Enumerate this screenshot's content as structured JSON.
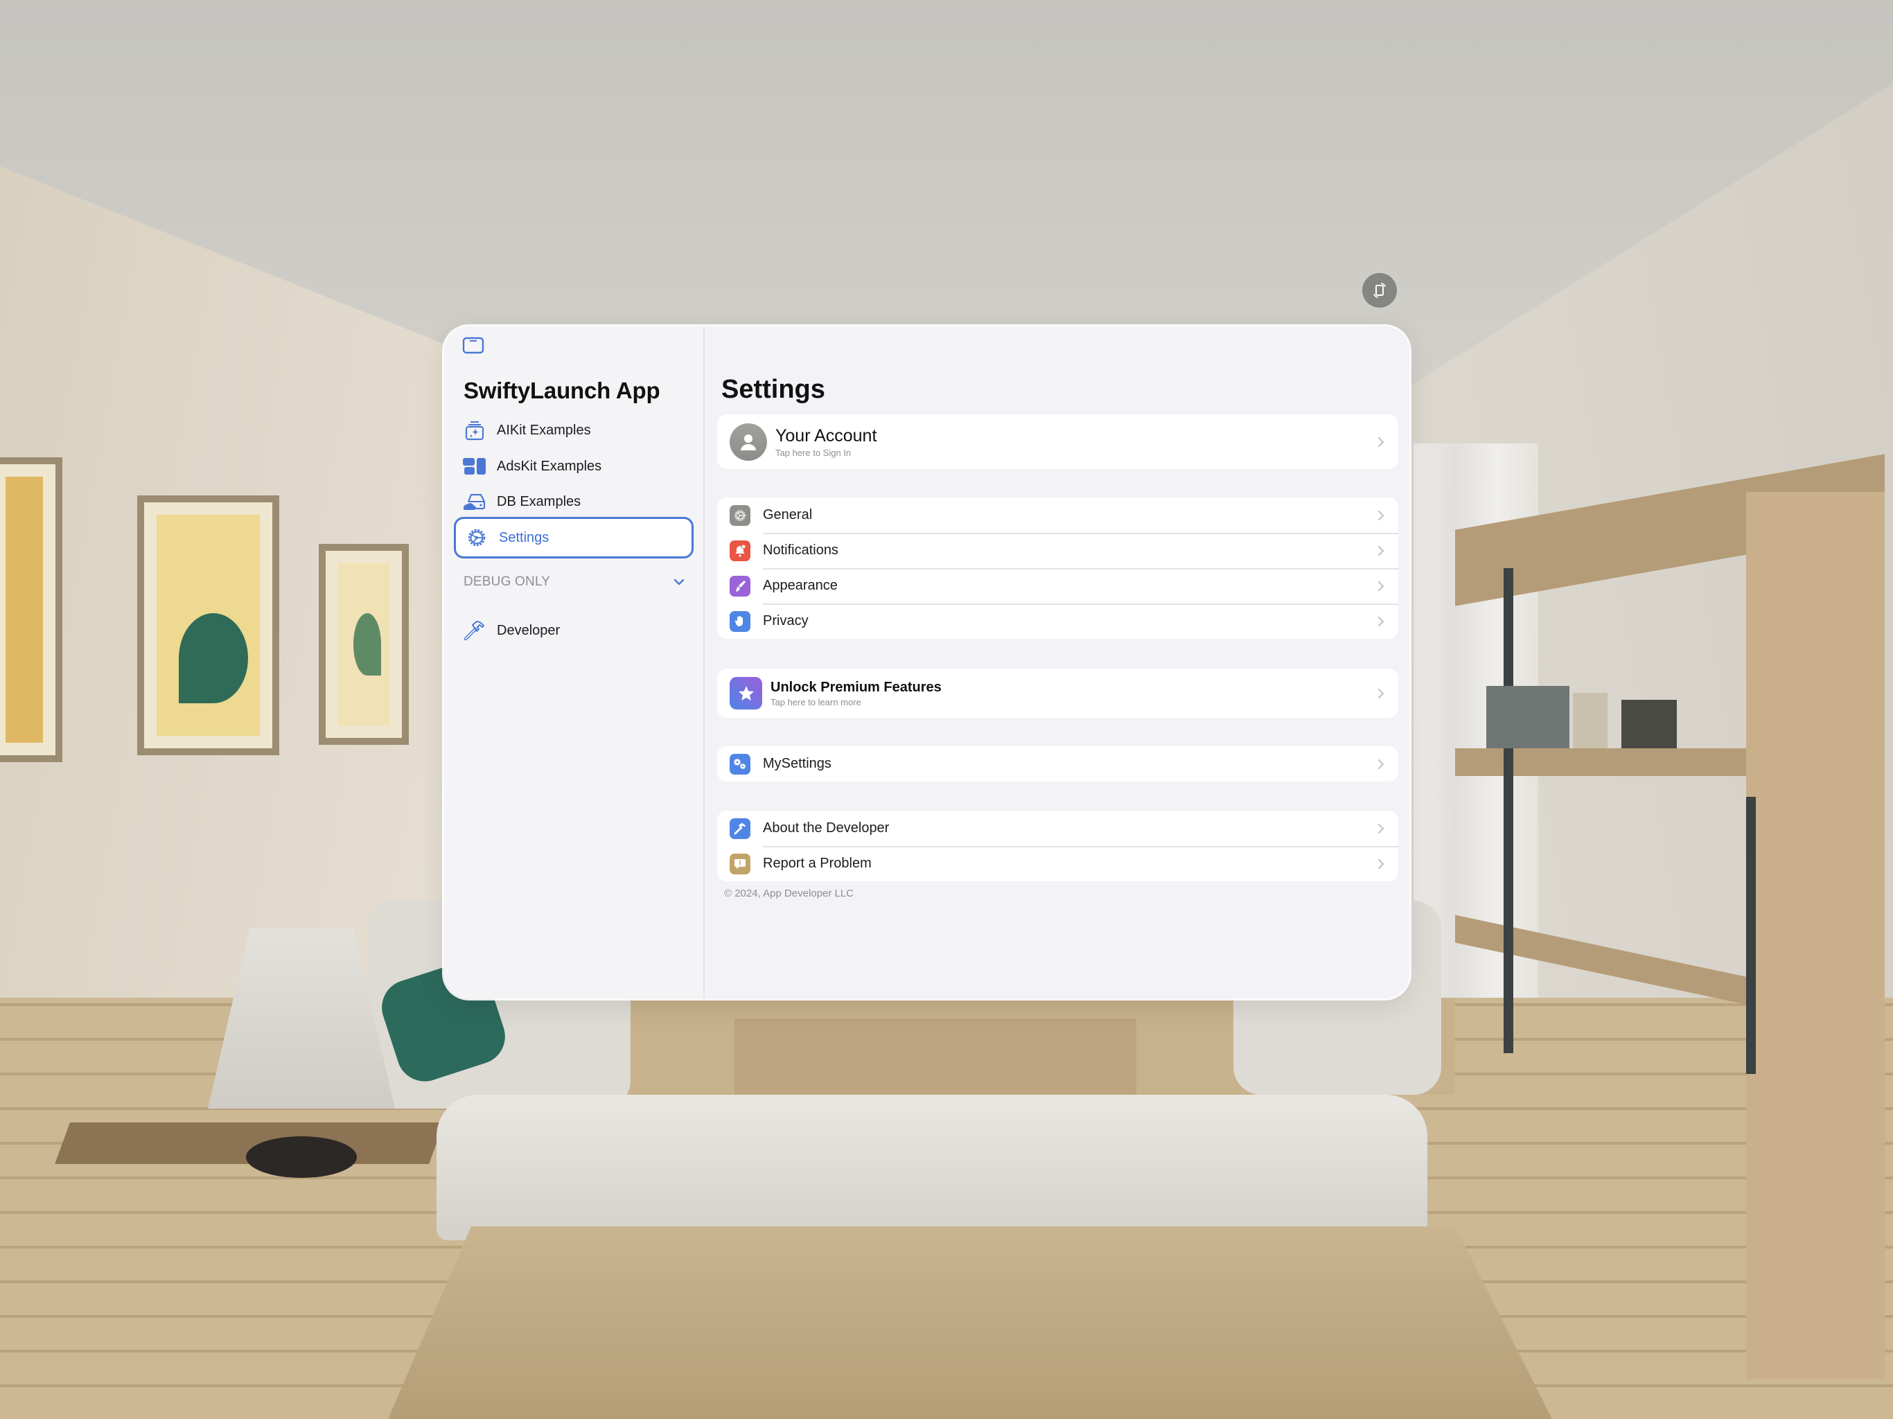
{
  "window": {
    "rotate_button_icon": "rotate-device-icon",
    "sidebar_toggle_icon": "sidebar-toggle-icon"
  },
  "sidebar": {
    "title": "SwiftyLaunch App",
    "items": [
      {
        "label": "AIKit Examples",
        "icon": "aikit-icon",
        "selected": false
      },
      {
        "label": "AdsKit Examples",
        "icon": "adskit-icon",
        "selected": false
      },
      {
        "label": "DB Examples",
        "icon": "database-cloud-icon",
        "selected": false
      },
      {
        "label": "Settings",
        "icon": "gear-icon",
        "selected": true
      }
    ],
    "section": {
      "title": "DEBUG ONLY",
      "expanded": true,
      "items": [
        {
          "label": "Developer",
          "icon": "hammer-icon"
        }
      ]
    }
  },
  "main": {
    "title": "Settings",
    "account": {
      "title": "Your Account",
      "subtitle": "Tap here to Sign In",
      "icon": "person-icon"
    },
    "groups": [
      {
        "rows": [
          {
            "label": "General",
            "icon": "gear-icon",
            "color": "#8e8e8a"
          },
          {
            "label": "Notifications",
            "icon": "bell-badge-icon",
            "color": "#eb5545"
          },
          {
            "label": "Appearance",
            "icon": "paintbrush-icon",
            "color": "#9b63d8"
          },
          {
            "label": "Privacy",
            "icon": "hand-raised-icon",
            "color": "#4f85e6"
          }
        ]
      }
    ],
    "premium": {
      "title": "Unlock Premium Features",
      "subtitle": "Tap here to learn more",
      "icon": "star-icon"
    },
    "my_settings": {
      "label": "MySettings",
      "icon": "gears-icon",
      "color": "#4f85e6"
    },
    "about_group": {
      "rows": [
        {
          "label": "About the Developer",
          "icon": "hammer-icon",
          "color": "#4f85e6"
        },
        {
          "label": "Report a Problem",
          "icon": "exclamation-bubble-icon",
          "color": "#c2a46a"
        }
      ]
    },
    "footer": "© 2024, App Developer LLC"
  },
  "colors": {
    "accent": "#4a78d4",
    "background": "#f2f2f7",
    "card": "#ffffff",
    "secondary_text": "#8e8e93"
  }
}
